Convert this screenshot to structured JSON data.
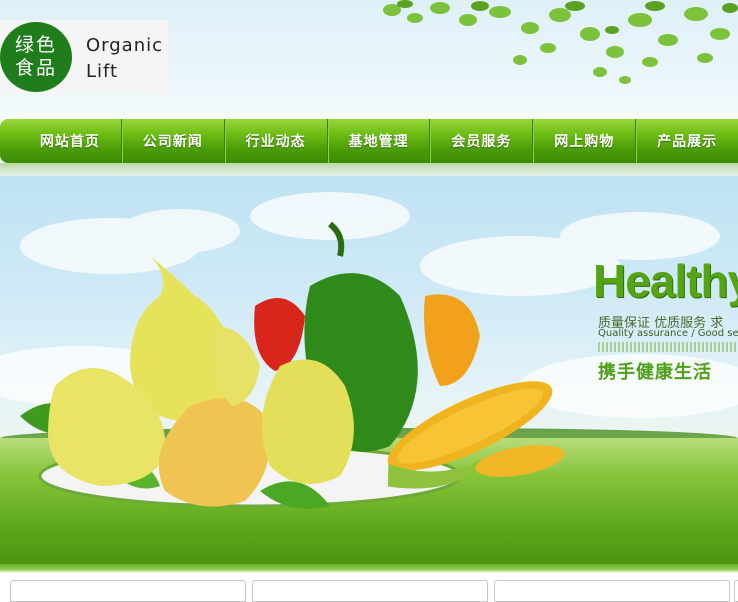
{
  "logo": {
    "cn_text": "绿色食品",
    "en_line1": "Organic",
    "en_line2": "Lift"
  },
  "nav": {
    "items": [
      {
        "label": "网站首页"
      },
      {
        "label": "公司新闻"
      },
      {
        "label": "行业动态"
      },
      {
        "label": "基地管理"
      },
      {
        "label": "会员服务"
      },
      {
        "label": "网上购物"
      },
      {
        "label": "产品展示"
      }
    ]
  },
  "banner": {
    "headline": "Healthy",
    "sub_cn": "质量保证 优质服务 求",
    "sub_en": "Quality assurance / Good serv",
    "slogan": "携手健康生活"
  },
  "colors": {
    "brand_green": "#1f7d1c",
    "nav_green": "#4a9c06",
    "headline_green": "#55a414"
  }
}
